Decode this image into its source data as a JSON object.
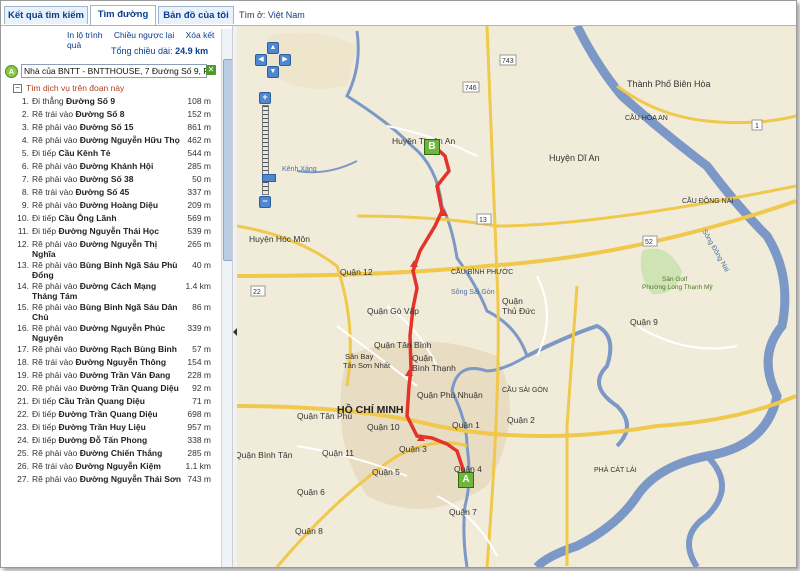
{
  "tabs": [
    {
      "label": "Kết quả tìm kiếm"
    },
    {
      "label": "Tìm đường"
    },
    {
      "label": "Bản đồ của tôi"
    }
  ],
  "location": {
    "prefix": "Tìm ở:",
    "country": "Việt Nam"
  },
  "panel": {
    "links": [
      "In lộ trình",
      "Chiều ngược lại",
      "Xóa kết quả"
    ],
    "total_label": "Tổng chiều dài:",
    "total_value": "24.9 km",
    "start_marker": "A",
    "start_value": "Nhà của BNTT - BNTTHOUSE, 7 Đường Số 9, Ph",
    "services_label": "Tìm dịch vụ trên đoạn này",
    "steps": [
      {
        "n": "1.",
        "action": "Đi thẳng",
        "road": "Đường Số 9",
        "dist": "108 m"
      },
      {
        "n": "2.",
        "action": "Rẽ trái vào",
        "road": "Đường Số 8",
        "dist": "152 m"
      },
      {
        "n": "3.",
        "action": "Rẽ phải vào",
        "road": "Đường Số 15",
        "dist": "861 m"
      },
      {
        "n": "4.",
        "action": "Rẽ phải vào",
        "road": "Đường Nguyễn Hữu Thọ",
        "dist": "462 m"
      },
      {
        "n": "5.",
        "action": "Đi tiếp",
        "road": "Cầu Kênh Tẻ",
        "dist": "544 m"
      },
      {
        "n": "6.",
        "action": "Rẽ phải vào",
        "road": "Đường Khánh Hội",
        "dist": "285 m"
      },
      {
        "n": "7.",
        "action": "Rẽ phải vào",
        "road": "Đường Số 38",
        "dist": "50 m"
      },
      {
        "n": "8.",
        "action": "Rẽ trái vào",
        "road": "Đường Số 45",
        "dist": "337 m"
      },
      {
        "n": "9.",
        "action": "Rẽ phải vào",
        "road": "Đường Hoàng Diệu",
        "dist": "209 m"
      },
      {
        "n": "10.",
        "action": "Đi tiếp",
        "road": "Cầu Ông Lãnh",
        "dist": "569 m"
      },
      {
        "n": "11.",
        "action": "Đi tiếp",
        "road": "Đường Nguyễn Thái Học",
        "dist": "539 m"
      },
      {
        "n": "12.",
        "action": "Rẽ phải vào",
        "road": "Đường Nguyễn Thị Nghĩa",
        "dist": "265 m"
      },
      {
        "n": "13.",
        "action": "Rẽ phải vào",
        "road": "Bùng Binh Ngã Sáu Phù Đổng",
        "dist": "40 m"
      },
      {
        "n": "14.",
        "action": "Rẽ phải vào",
        "road": "Đường Cách Mạng Tháng Tám",
        "dist": "1.4 km"
      },
      {
        "n": "15.",
        "action": "Rẽ phải vào",
        "road": "Bùng Binh Ngã Sáu Dân Chủ",
        "dist": "86 m"
      },
      {
        "n": "16.",
        "action": "Rẽ phải vào",
        "road": "Đường Nguyễn Phúc Nguyên",
        "dist": "339 m"
      },
      {
        "n": "17.",
        "action": "Rẽ phải vào",
        "road": "Đường Rạch Bùng Binh",
        "dist": "57 m"
      },
      {
        "n": "18.",
        "action": "Rẽ trái vào",
        "road": "Đường Nguyễn Thông",
        "dist": "154 m"
      },
      {
        "n": "19.",
        "action": "Rẽ phải vào",
        "road": "Đường Trần Văn Đang",
        "dist": "228 m"
      },
      {
        "n": "20.",
        "action": "Rẽ phải vào",
        "road": "Đường Trần Quang Diệu",
        "dist": "92 m"
      },
      {
        "n": "21.",
        "action": "Đi tiếp",
        "road": "Cầu Trần Quang Diệu",
        "dist": "71 m"
      },
      {
        "n": "22.",
        "action": "Đi tiếp",
        "road": "Đường Trần Quang Diệu",
        "dist": "698 m"
      },
      {
        "n": "23.",
        "action": "Đi tiếp",
        "road": "Đường Trần Huy Liệu",
        "dist": "957 m"
      },
      {
        "n": "24.",
        "action": "Đi tiếp",
        "road": "Đường Đỗ Tấn Phong",
        "dist": "338 m"
      },
      {
        "n": "25.",
        "action": "Rẽ phải vào",
        "road": "Đường Chiến Thắng",
        "dist": "285 m"
      },
      {
        "n": "26.",
        "action": "Rẽ trái vào",
        "road": "Đường Nguyễn Kiệm",
        "dist": "1.1 km"
      },
      {
        "n": "27.",
        "action": "Rẽ phải vào",
        "road": "Đường Nguyễn Thái Sơn",
        "dist": "743 m"
      }
    ]
  },
  "map": {
    "labels": [
      "Thành Phố Biên Hòa",
      "Huyện Dĩ An",
      "Huyện Thuận An",
      "Huyện Hóc Môn",
      "Quận 12",
      "Quận Gò Vấp",
      "Quận Thủ Đức",
      "Quận 9",
      "Quận Tân Bình",
      "Quận Bình Thạnh",
      "Sân Bay Tân Sơn Nhất",
      "Quận Phú Nhuận",
      "HỒ CHÍ MINH",
      "Quận Tân Phú",
      "Quận 10",
      "Quận 1",
      "Quận 2",
      "Quận 11",
      "Quận 3",
      "Quận 4",
      "Quận 5",
      "Quận 6",
      "Quận 8",
      "Quận 7",
      "Quận Bình Tân",
      "Quận",
      "CẦU HÓA AN",
      "CẦU ĐỒNG NAI",
      "CẦU BÌNH PHƯỚC",
      "CẦU SÀI GÒN",
      "PHÀ CÁT LÁI",
      "Sân Golf Phường Long Thạnh Mỹ",
      "Sông Sài Gòn",
      "Kênh Xáng",
      "Sông Đồng Nai"
    ],
    "route_codes": [
      "743",
      "746",
      "1",
      "22",
      "13",
      "52"
    ],
    "marker_a": "A",
    "marker_b": "B"
  },
  "colors": {
    "route": "#e2342b",
    "river": "#7b98c6",
    "highway": "#f0c84b",
    "land": "#f1ecd9",
    "accent": "#0a3d91"
  }
}
